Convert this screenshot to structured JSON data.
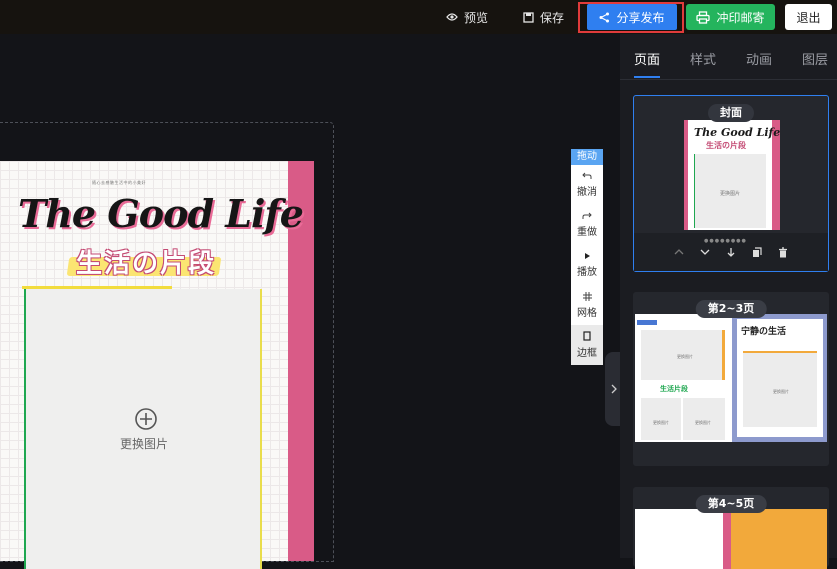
{
  "toolbar": {
    "preview_label": "预览",
    "save_label": "保存",
    "share_label": "分享发布",
    "print_label": "冲印邮寄",
    "exit_label": "退出"
  },
  "canvas": {
    "page_tag": "随心去感触生活中的小美好",
    "page_title": "The Good Life",
    "page_subtitle": "生活の片段",
    "replace_label": "更换图片"
  },
  "tools": {
    "drag_label": "拖动",
    "undo_label": "撤消",
    "redo_label": "重做",
    "play_label": "播放",
    "grid_label": "网格",
    "border_label": "边框"
  },
  "panel": {
    "tabs": [
      {
        "label": "页面"
      },
      {
        "label": "样式"
      },
      {
        "label": "动画"
      },
      {
        "label": "图层"
      }
    ],
    "cards": [
      {
        "label": "封面",
        "thumb_title": "The Good Life",
        "thumb_subtitle": "生活の片段",
        "thumb_replace": "更换图片"
      },
      {
        "label": "第2~3页",
        "left_caption": "生活片段",
        "right_title": "宁静の生活",
        "replace": "更换图片"
      },
      {
        "label": "第4~5页"
      }
    ]
  },
  "colors": {
    "accent": "#2f7ff0",
    "print": "#24b45d",
    "pink": "#d95b87",
    "highlight": "#e03b3b"
  }
}
